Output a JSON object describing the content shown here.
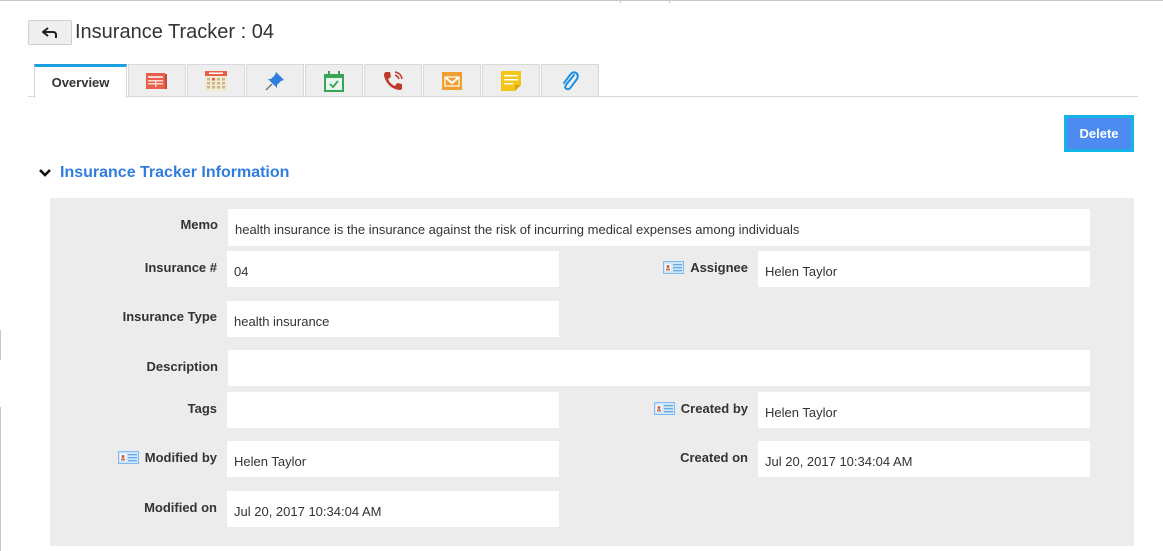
{
  "header": {
    "back_icon": "back-arrow-icon",
    "title": "Insurance Tracker : 04"
  },
  "tabs": [
    {
      "label": "Overview",
      "active": true
    },
    {
      "icon": "details-list-icon",
      "color": "#e8604c"
    },
    {
      "icon": "calendar-icon",
      "color": "#e8604c"
    },
    {
      "icon": "pin-icon",
      "color": "#2f7de0"
    },
    {
      "icon": "task-calendar-check-icon",
      "color": "#3aa357"
    },
    {
      "icon": "phone-call-icon",
      "color": "#c0392b"
    },
    {
      "icon": "email-icon",
      "color": "#f0a030"
    },
    {
      "icon": "notes-icon",
      "color": "#f5c518"
    },
    {
      "icon": "attachment-icon",
      "color": "#1e90e0"
    }
  ],
  "actions": {
    "delete_label": "Delete"
  },
  "section": {
    "title": "Insurance Tracker Information",
    "collapse_icon": "chevron-down-icon"
  },
  "fields": {
    "memo": {
      "label": "Memo",
      "value": "health insurance is the insurance against the risk of incurring medical expenses among individuals"
    },
    "insurance_number": {
      "label": "Insurance #",
      "value": "04"
    },
    "assignee": {
      "label": "Assignee",
      "value": "Helen Taylor",
      "icon": "contact-card-icon"
    },
    "insurance_type": {
      "label": "Insurance Type",
      "value": "health insurance"
    },
    "description": {
      "label": "Description",
      "value": ""
    },
    "tags": {
      "label": "Tags",
      "value": ""
    },
    "created_by": {
      "label": "Created by",
      "value": "Helen Taylor",
      "icon": "contact-card-icon"
    },
    "modified_by": {
      "label": "Modified by",
      "value": "Helen Taylor",
      "icon": "contact-card-icon"
    },
    "created_on": {
      "label": "Created on",
      "value": "Jul 20, 2017 10:34:04 AM"
    },
    "modified_on": {
      "label": "Modified on",
      "value": "Jul 20, 2017 10:34:04 AM"
    }
  },
  "colors": {
    "accent_blue": "#2f7de0",
    "delete_bg": "#4d8bf0",
    "delete_border": "#15b3e8",
    "panel_bg": "#ececec",
    "active_tab_bar": "#1e9fe0"
  }
}
